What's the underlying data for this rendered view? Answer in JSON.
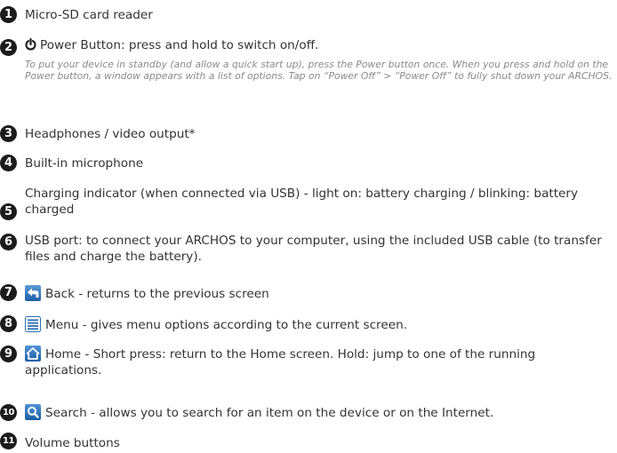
{
  "items": [
    {
      "number": "1",
      "text": "Micro-SD card reader"
    },
    {
      "number": "2",
      "text": "Power Button: press and hold to switch on/off.",
      "icon": "power-icon",
      "note": "To put your device in standby (and allow a quick start up), press the Power button once. When you press and hold on the Power button, a window appears with a list of options. Tap on “Power Off” > “Power Off” to fully shut down your ARCHOS."
    },
    {
      "number": "3",
      "text": "Headphones / video output*"
    },
    {
      "number": "4",
      "text": "Built-in microphone"
    },
    {
      "number": "5",
      "text": "Charging indicator (when connected via USB) - light on: battery charging / blinking: battery charged"
    },
    {
      "number": "6",
      "text": "USB port: to connect your ARCHOS to your computer, using the included USB cable (to transfer files and charge the battery)."
    },
    {
      "number": "7",
      "text": "Back - returns to the previous screen",
      "icon": "back-icon"
    },
    {
      "number": "8",
      "text": "Menu - gives menu options according to the current screen.",
      "icon": "menu-icon"
    },
    {
      "number": "9",
      "text": "Home - Short press: return to the Home screen. Hold: jump to one of the running applications.",
      "icon": "home-icon"
    },
    {
      "number": "10",
      "text": "Search - allows you to search for an item on the device or on the Internet.",
      "icon": "search-icon"
    },
    {
      "number": "11",
      "text": "Volume buttons"
    }
  ],
  "colors": {
    "badge": "#1b1b1b",
    "text": "#333333",
    "note": "#8a8a8a",
    "icon_blue": "#1f6fbf"
  }
}
